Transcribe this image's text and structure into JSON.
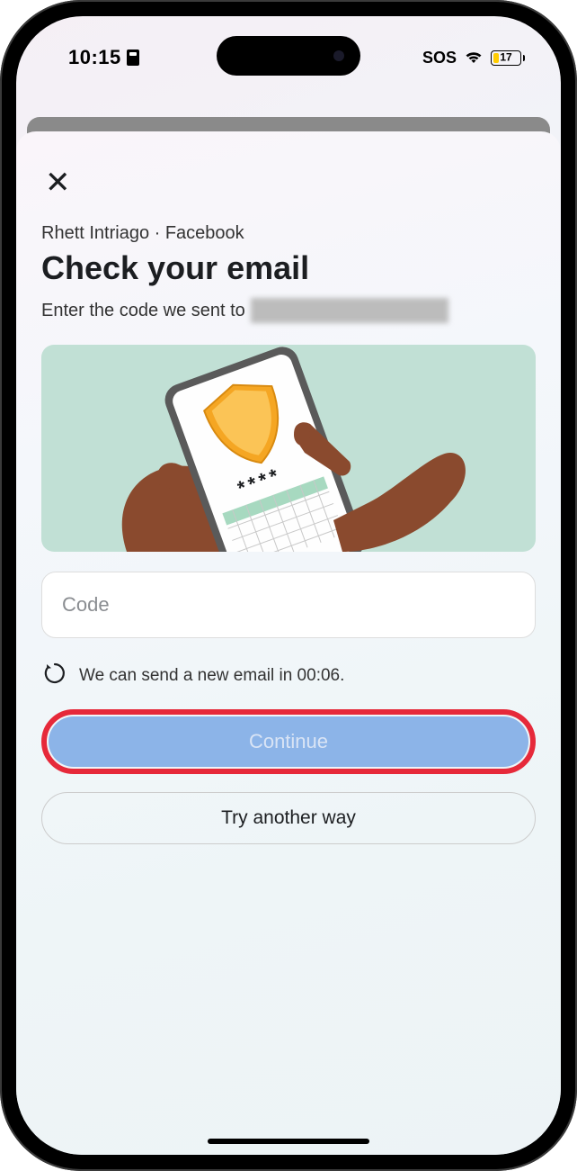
{
  "status_bar": {
    "time": "10:15",
    "sos": "SOS",
    "battery_percent": "17"
  },
  "modal": {
    "breadcrumb": "Rhett Intriago · Facebook",
    "title": "Check your email",
    "instruction": "Enter the code we sent to",
    "code_placeholder": "Code",
    "resend_text": "We can send a new email in 00:06.",
    "continue_label": "Continue",
    "try_another_label": "Try another way"
  }
}
